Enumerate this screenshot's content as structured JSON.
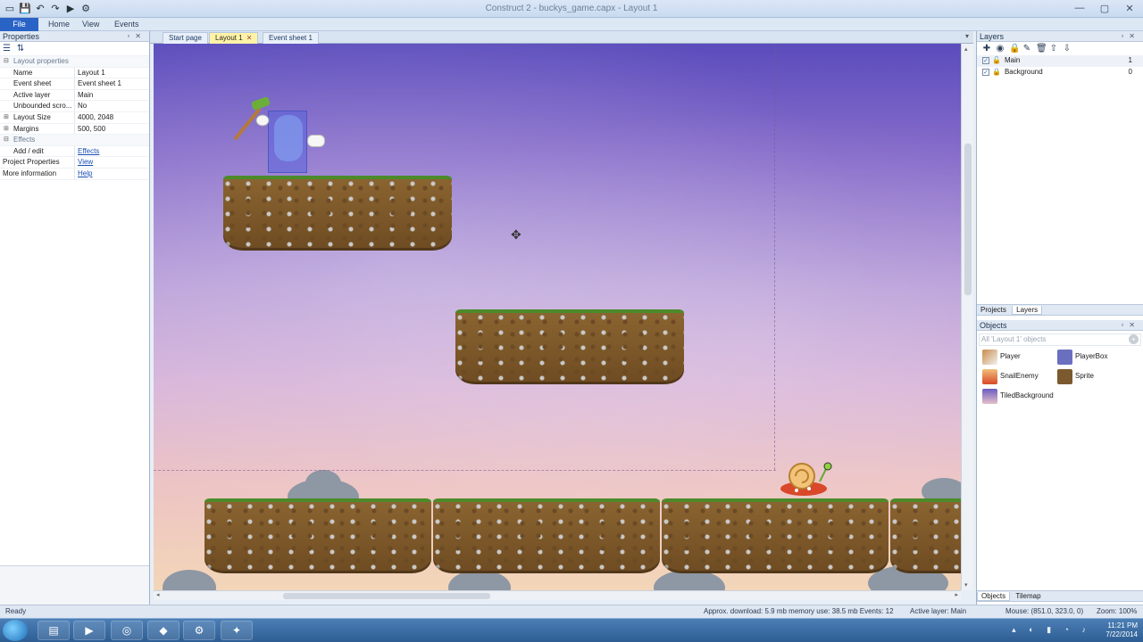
{
  "window": {
    "title": "Construct 2 - buckys_game.capx - Layout 1",
    "qat_icons": [
      "new-icon",
      "save-icon",
      "undo-icon",
      "redo-icon",
      "preview-icon",
      "debug-icon"
    ]
  },
  "menu": {
    "file": "File",
    "home": "Home",
    "view": "View",
    "events": "Events"
  },
  "properties": {
    "title": "Properties",
    "rows": [
      {
        "type": "section",
        "label": "Layout properties"
      },
      {
        "key": "Name",
        "value": "Layout 1"
      },
      {
        "key": "Event sheet",
        "value": "Event sheet 1"
      },
      {
        "key": "Active layer",
        "value": "Main"
      },
      {
        "key": "Unbounded scro...",
        "value": "No"
      },
      {
        "key": "Layout Size",
        "value": "4000, 2048",
        "expandable": true
      },
      {
        "key": "Margins",
        "value": "500, 500",
        "expandable": true
      },
      {
        "type": "section",
        "label": "Effects"
      },
      {
        "key": "Add / edit",
        "value": "Effects",
        "link": true
      },
      {
        "key": "Project Properties",
        "value": "View",
        "link": true,
        "top": true
      },
      {
        "key": "More information",
        "value": "Help",
        "link": true,
        "top": true
      }
    ]
  },
  "tabs": [
    {
      "label": "Start page",
      "active": false
    },
    {
      "label": "Layout 1",
      "active": true
    },
    {
      "label": "Event sheet 1",
      "active": false
    }
  ],
  "layers": {
    "title": "Layers",
    "items": [
      {
        "name": "Main",
        "count": "1"
      },
      {
        "name": "Background",
        "count": "0"
      }
    ],
    "subtabs": [
      "Projects",
      "Layers"
    ]
  },
  "objects": {
    "title": "Objects",
    "filter_placeholder": "All 'Layout 1' objects",
    "items": [
      {
        "name": "Player"
      },
      {
        "name": "PlayerBox"
      },
      {
        "name": "SnailEnemy"
      },
      {
        "name": "Sprite"
      },
      {
        "name": "TiledBackground"
      }
    ],
    "subtabs": [
      "Objects",
      "Tilemap"
    ]
  },
  "status": {
    "ready": "Ready",
    "approx": "Approx. download: 5.9 mb  memory use: 38.5 mb  Events: 12",
    "active_layer": "Active layer: Main",
    "mouse": "Mouse: (851.0, 323.0, 0)",
    "zoom": "Zoom: 100%"
  },
  "taskbar": {
    "time": "11:21 PM",
    "date": "7/22/2014"
  }
}
